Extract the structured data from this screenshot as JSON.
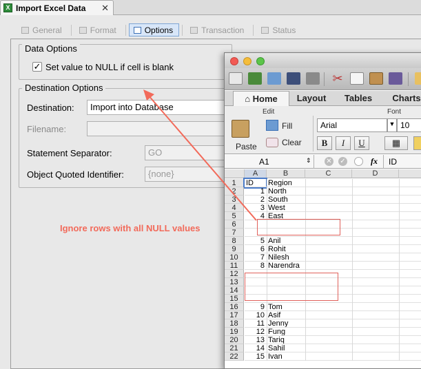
{
  "window": {
    "tab_title": "Import Excel Data",
    "close_glyph": "✕"
  },
  "tabs": [
    {
      "label": "General",
      "active": false
    },
    {
      "label": "Format",
      "active": false
    },
    {
      "label": "Options",
      "active": true
    },
    {
      "label": "Transaction",
      "active": false
    },
    {
      "label": "Status",
      "active": false
    }
  ],
  "data_options": {
    "legend": "Data Options",
    "null_blank_label": "Set value to NULL if cell is blank",
    "null_blank_checked": true
  },
  "destination_options": {
    "legend": "Destination Options",
    "destination_label": "Destination:",
    "destination_value": "Import into Database",
    "filename_label": "Filename:",
    "filename_value": "",
    "separator_label": "Statement Separator:",
    "separator_value": "GO",
    "quoted_label": "Object Quoted Identifier:",
    "quoted_value": "{none}"
  },
  "annotation": {
    "text": "Ignore rows with all NULL values",
    "color": "#f26a5a"
  },
  "excel": {
    "ribbon_tabs": [
      "Home",
      "Layout",
      "Tables",
      "Charts"
    ],
    "active_ribbon_tab": "Home",
    "edit_group": "Edit",
    "font_group": "Font",
    "paste_label": "Paste",
    "fill_label": "Fill",
    "clear_label": "Clear",
    "font_name": "Arial",
    "font_size": "10",
    "bold": "B",
    "italic": "I",
    "underline": "U",
    "name_box": "A1",
    "fx": "fx",
    "formula": "ID",
    "columns": [
      "A",
      "B",
      "C",
      "D"
    ],
    "rows": [
      {
        "n": "1",
        "a": "ID",
        "b": "Region"
      },
      {
        "n": "2",
        "a": "1",
        "b": "North"
      },
      {
        "n": "3",
        "a": "2",
        "b": "South"
      },
      {
        "n": "4",
        "a": "3",
        "b": "West"
      },
      {
        "n": "5",
        "a": "4",
        "b": "East"
      },
      {
        "n": "6",
        "a": "",
        "b": ""
      },
      {
        "n": "7",
        "a": "",
        "b": ""
      },
      {
        "n": "8",
        "a": "5",
        "b": "Anil"
      },
      {
        "n": "9",
        "a": "6",
        "b": "Rohit"
      },
      {
        "n": "10",
        "a": "7",
        "b": "Nilesh"
      },
      {
        "n": "11",
        "a": "8",
        "b": "Narendra"
      },
      {
        "n": "12",
        "a": "",
        "b": ""
      },
      {
        "n": "13",
        "a": "",
        "b": ""
      },
      {
        "n": "14",
        "a": "",
        "b": ""
      },
      {
        "n": "15",
        "a": "",
        "b": ""
      },
      {
        "n": "16",
        "a": "9",
        "b": "Tom"
      },
      {
        "n": "17",
        "a": "10",
        "b": "Asif"
      },
      {
        "n": "18",
        "a": "11",
        "b": "Jenny"
      },
      {
        "n": "19",
        "a": "12",
        "b": "Fung"
      },
      {
        "n": "20",
        "a": "13",
        "b": "Tariq"
      },
      {
        "n": "21",
        "a": "14",
        "b": "Sahil"
      },
      {
        "n": "22",
        "a": "15",
        "b": "Ivan"
      }
    ]
  }
}
